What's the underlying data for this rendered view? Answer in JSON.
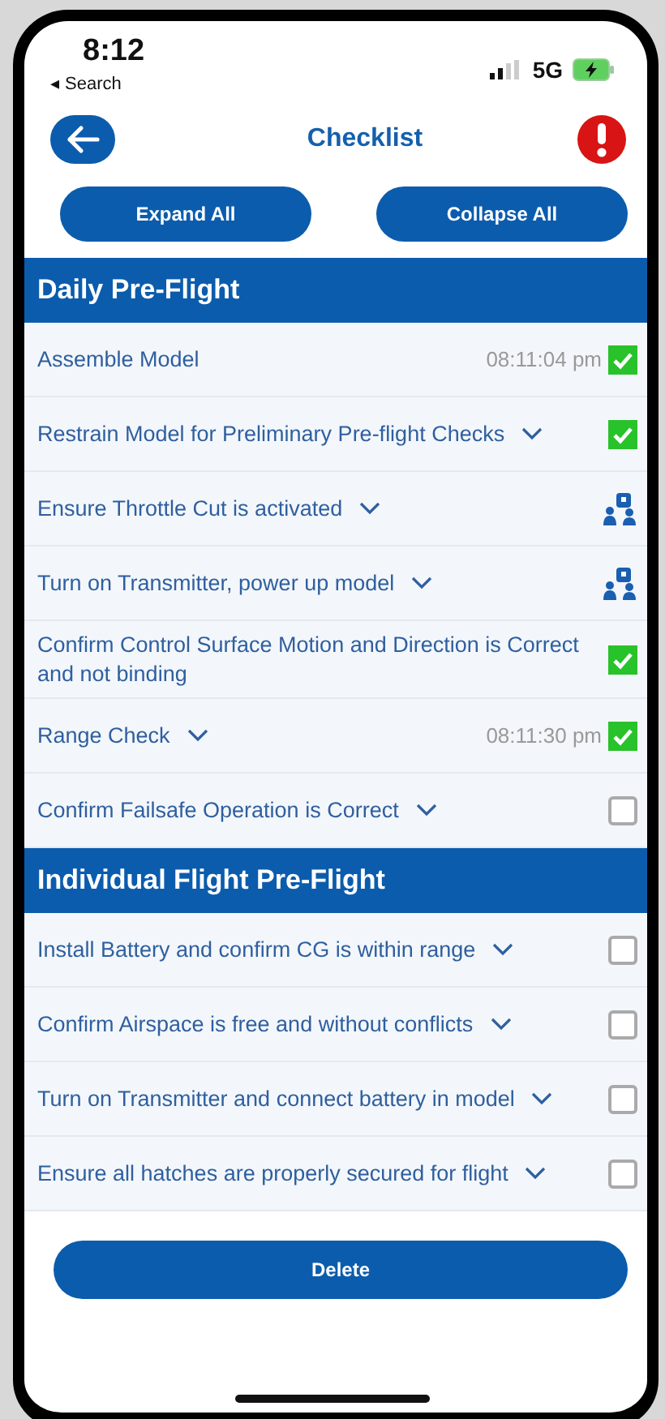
{
  "status_bar": {
    "time": "8:12",
    "back_label": "◂ Search",
    "network": "5G"
  },
  "nav": {
    "title": "Checklist"
  },
  "actions": [
    "Expand All",
    "Collapse All"
  ],
  "sections": [
    {
      "title": "Daily Pre-Flight",
      "items": [
        {
          "label": "Assemble Model",
          "kind": "checkbox",
          "checked": true,
          "chevron": false,
          "time": "08:11:04 pm"
        },
        {
          "label": "Restrain Model for Preliminary Pre-flight Checks",
          "kind": "checkbox",
          "checked": true,
          "chevron": true
        },
        {
          "label": "Ensure Throttle Cut is activated",
          "kind": "pilot",
          "chevron": true
        },
        {
          "label": "Turn on Transmitter, power up model",
          "kind": "pilot",
          "chevron": true
        },
        {
          "label": "Confirm Control Surface Motion and Direction is Correct and not binding",
          "kind": "checkbox",
          "checked": true,
          "chevron": false
        },
        {
          "label": "Range Check",
          "kind": "checkbox",
          "checked": true,
          "chevron": true,
          "time": "08:11:30 pm"
        },
        {
          "label": "Confirm Failsafe Operation is Correct",
          "kind": "checkbox",
          "checked": false,
          "chevron": true
        }
      ]
    },
    {
      "title": "Individual Flight Pre-Flight",
      "items": [
        {
          "label": "Install Battery and confirm CG is within range",
          "kind": "checkbox",
          "checked": false,
          "chevron": true
        },
        {
          "label": "Confirm Airspace is free and without conflicts",
          "kind": "checkbox",
          "checked": false,
          "chevron": true
        },
        {
          "label": "Turn on Transmitter and connect battery in model",
          "kind": "checkbox",
          "checked": false,
          "chevron": true
        },
        {
          "label": "Ensure all hatches are properly secured for flight",
          "kind": "checkbox",
          "checked": false,
          "chevron": true
        }
      ]
    }
  ],
  "delete_button": "Delete"
}
